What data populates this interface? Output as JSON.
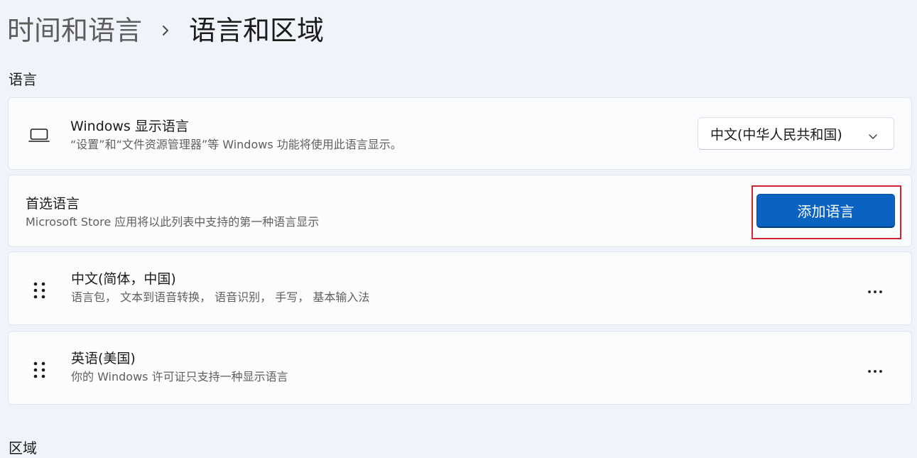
{
  "breadcrumb": {
    "parent": "时间和语言",
    "separator_icon": "chevron-right-icon",
    "current": "语言和区域"
  },
  "language_section": {
    "label": "语言"
  },
  "windows_display_language": {
    "icon": "laptop-icon",
    "title": "Windows 显示语言",
    "description": "“设置”和“文件资源管理器”等 Windows 功能将使用此语言显示。",
    "selected_value": "中文(中华人民共和国)",
    "dropdown_icon": "chevron-down-icon"
  },
  "preferred_languages": {
    "title": "首选语言",
    "description": "Microsoft Store 应用将以此列表中支持的第一种语言显示",
    "add_button_label": "添加语言",
    "highlight_color": "#d12430"
  },
  "languages": [
    {
      "name": "中文(简体，中国)",
      "features": "语言包， 文本到语音转换， 语音识别， 手写， 基本输入法",
      "drag_icon": "drag-handle-icon",
      "more_icon": "more-options-icon"
    },
    {
      "name": "英语(美国)",
      "features": "你的 Windows 许可证只支持一种显示语言",
      "drag_icon": "drag-handle-icon",
      "more_icon": "more-options-icon"
    }
  ],
  "region_section": {
    "label": "区域"
  },
  "colors": {
    "accent": "#0a63c1",
    "page_background": "#f0f3f9",
    "card_background": "#fbfcfe"
  }
}
